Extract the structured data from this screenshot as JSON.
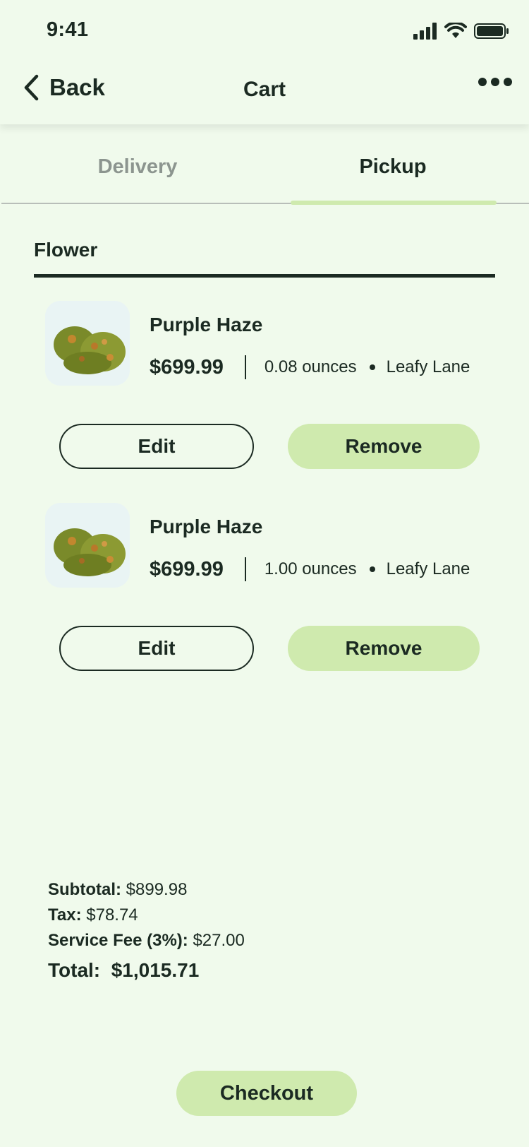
{
  "status_bar": {
    "time": "9:41"
  },
  "header": {
    "back_label": "Back",
    "title": "Cart"
  },
  "tabs": [
    {
      "label": "Delivery",
      "active": false
    },
    {
      "label": "Pickup",
      "active": true
    }
  ],
  "section": {
    "title": "Flower"
  },
  "items": [
    {
      "name": "Purple Haze",
      "price": "$699.99",
      "quantity": "0.08 ounces",
      "store": "Leafy Lane",
      "edit_label": "Edit",
      "remove_label": "Remove"
    },
    {
      "name": "Purple Haze",
      "price": "$699.99",
      "quantity": "1.00 ounces",
      "store": "Leafy Lane",
      "edit_label": "Edit",
      "remove_label": "Remove"
    }
  ],
  "summary": {
    "subtotal_label": "Subtotal:",
    "subtotal": "$899.98",
    "tax_label": "Tax:",
    "tax": "$78.74",
    "service_fee_label": "Service Fee (3%):",
    "service_fee": "$27.00",
    "total_label": "Total:",
    "total": "$1,015.71"
  },
  "checkout_label": "Checkout",
  "colors": {
    "background": "#F0FAEC",
    "accent": "#CFEAAE",
    "text": "#1B2A22",
    "inactive_tab": "#8C958F"
  }
}
